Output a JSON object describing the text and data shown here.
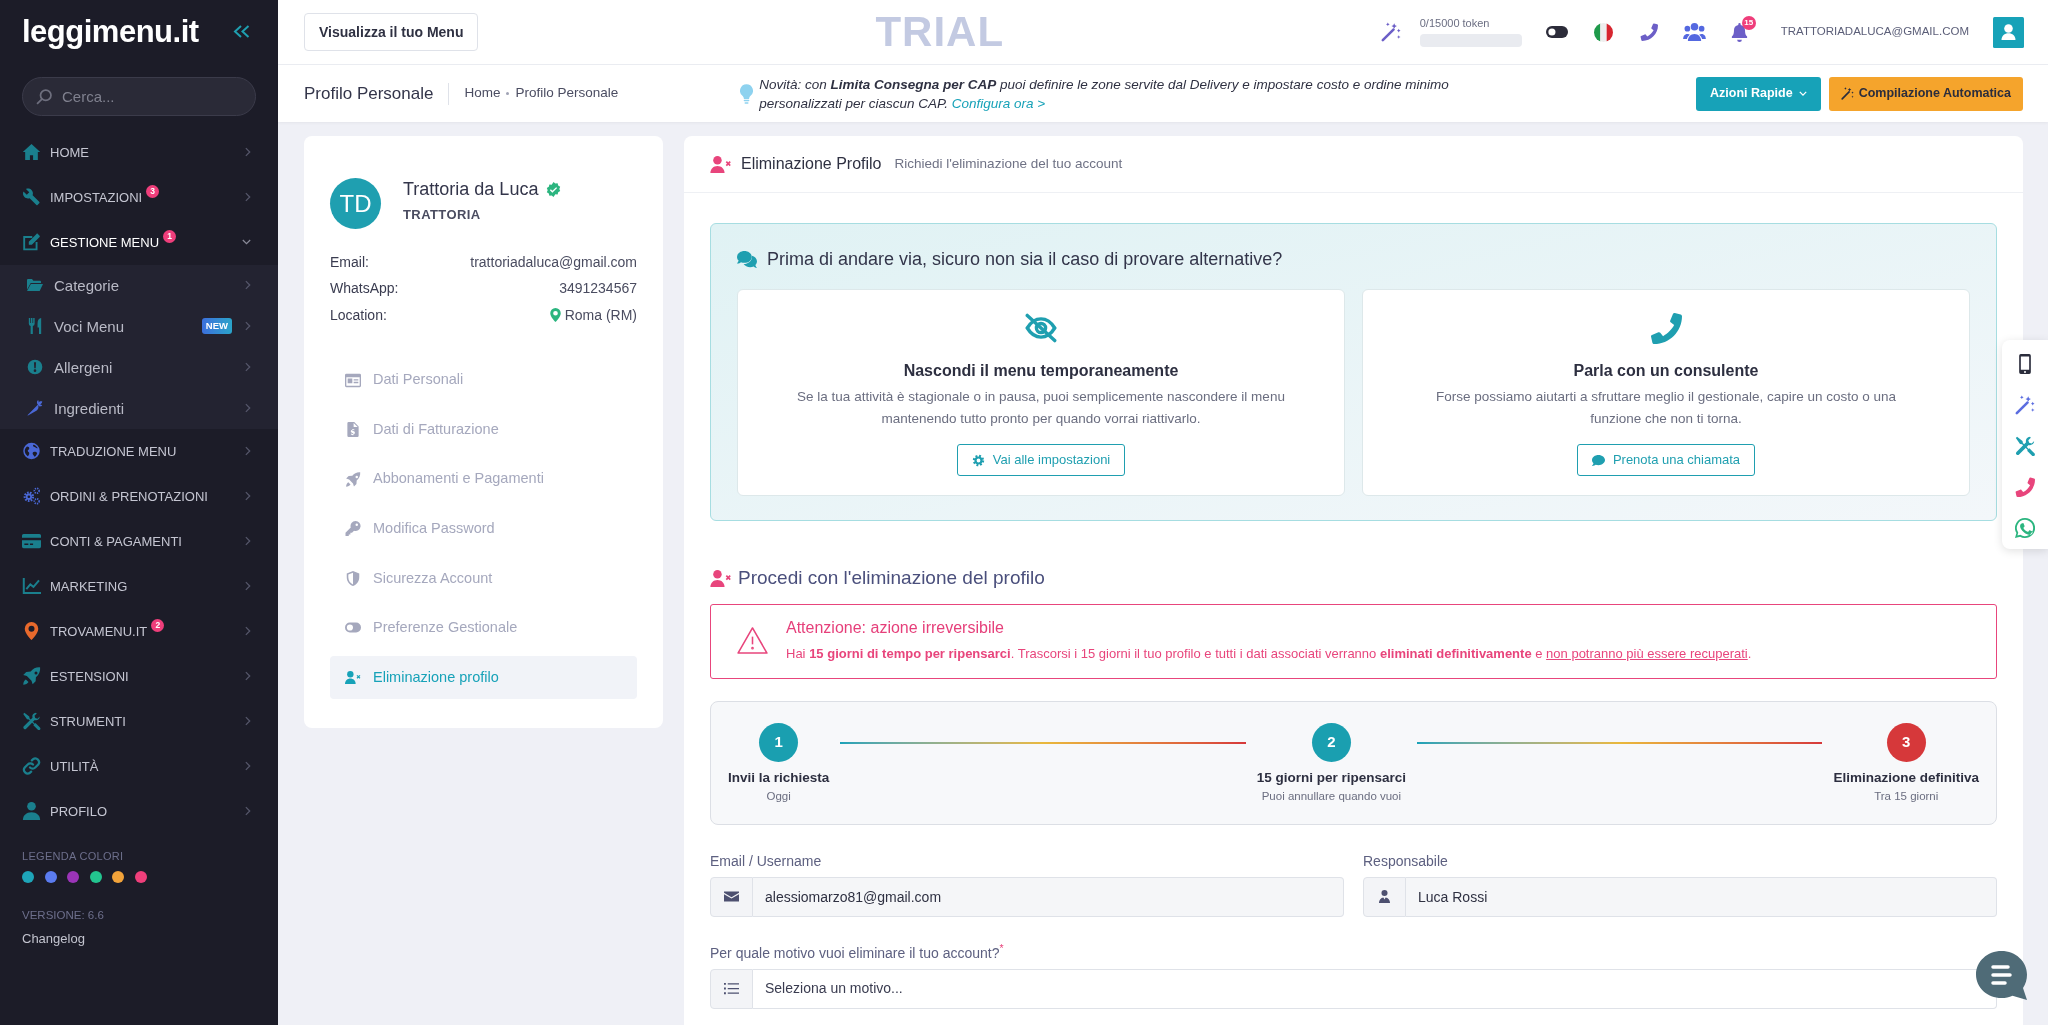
{
  "sidebar": {
    "logo": "leggimenu.it",
    "search": {
      "placeholder": "Cerca..."
    },
    "items": [
      {
        "label": "HOME",
        "color": "#1a7f8d",
        "expanded": false
      },
      {
        "label": "IMPOSTAZIONI",
        "color": "#1a7f8d",
        "badge": {
          "text": "3",
          "kind": "count"
        },
        "expanded": false
      },
      {
        "label": "GESTIONE MENU",
        "color": "#1a7f8d",
        "badge": {
          "text": "1",
          "kind": "count"
        },
        "expanded": true,
        "children": [
          {
            "label": "Categorie",
            "color": "#1a7f8d"
          },
          {
            "label": "Voci Menu",
            "color": "#1a7f8d",
            "badge": {
              "text": "NEW",
              "kind": "new"
            }
          },
          {
            "label": "Allergeni",
            "color": "#1a7f8d"
          },
          {
            "label": "Ingredienti",
            "color": "#4a68d6"
          }
        ]
      },
      {
        "label": "TRADUZIONE MENU",
        "color": "#4a68d6",
        "expanded": false
      },
      {
        "label": "ORDINI & PRENOTAZIONI",
        "color": "#4a68d6",
        "expanded": false
      },
      {
        "label": "CONTI & PAGAMENTI",
        "color": "#1a7f8d",
        "expanded": false
      },
      {
        "label": "MARKETING",
        "color": "#1a7f8d",
        "expanded": false
      },
      {
        "label": "TROVAMENU.IT",
        "color": "#e8692c",
        "badge": {
          "text": "2",
          "kind": "count"
        },
        "expanded": false
      },
      {
        "label": "ESTENSIONI",
        "color": "#1a7f8d",
        "expanded": false
      },
      {
        "label": "STRUMENTI",
        "color": "#1a7f8d",
        "expanded": false
      },
      {
        "label": "UTILITÀ",
        "color": "#1a7f8d",
        "expanded": false
      },
      {
        "label": "PROFILO",
        "color": "#1a7f8d",
        "expanded": false
      }
    ],
    "legend": {
      "title": "LEGENDA COLORI",
      "colors": [
        {
          "color": "#1ea5b9"
        },
        {
          "color": "#5b7cf0"
        },
        {
          "color": "#9b34b8"
        },
        {
          "color": "#23c48f"
        },
        {
          "color": "#f2a33a"
        },
        {
          "color": "#ef3f7b"
        }
      ]
    },
    "version": "VERSIONE: 6.6",
    "changelog": "Changelog"
  },
  "header": {
    "view_menu_button": "Visualizza il tuo Menu",
    "plan_label": "TRIAL",
    "tokens": {
      "text": "0/15000 token",
      "level": 0
    },
    "notifications_badge": "15",
    "user_email": "TRATTORIADALUCA@GMAIL.COM"
  },
  "subheader": {
    "title": "Profilo Personale",
    "breadcrumb": [
      {
        "label": "Home"
      },
      {
        "label": "Profilo Personale"
      }
    ],
    "notice": {
      "text": "Novità: con **Limita Consegna per CAP** puoi definire le zone servite dal Delivery e impostare costo e ordine minimo personalizzati per ciascun CAP.",
      "link": "Configura ora >"
    },
    "quick_actions_button": "Azioni Rapide",
    "autofill_button": "Compilazione Automatica"
  },
  "profile_card": {
    "initials": "TD",
    "name": "Trattoria da Luca",
    "verified": true,
    "type": "TRATTORIA",
    "details": [
      {
        "label": "Email:",
        "value": "trattoriadaluca@gmail.com",
        "kind": "text"
      },
      {
        "label": "WhatsApp:",
        "value": "3491234567",
        "kind": "text"
      },
      {
        "label": "Location:",
        "value": "Roma (RM)",
        "kind": "location"
      }
    ],
    "nav": [
      {
        "label": "Dati Personali",
        "selected": false
      },
      {
        "label": "Dati di Fatturazione",
        "selected": false
      },
      {
        "label": "Abbonamenti e Pagamenti",
        "selected": false
      },
      {
        "label": "Modifica Password",
        "selected": false
      },
      {
        "label": "Sicurezza Account",
        "selected": false
      },
      {
        "label": "Preferenze Gestionale",
        "selected": false
      },
      {
        "label": "Eliminazione profilo",
        "selected": true
      }
    ]
  },
  "main": {
    "title": "Eliminazione Profilo",
    "subtitle": "Richiedi l'eliminazione del tuo account",
    "alternatives": {
      "title": "Prima di andare via, sicuro non sia il caso di provare alternative?",
      "options": [
        {
          "title": "Nascondi il menu temporaneamente",
          "text": "Se la tua attività è stagionale o in pausa, puoi semplicemente nascondere il menu mantenendo tutto pronto per quando vorrai riattivarlo.",
          "button": "Vai alle impostazioni"
        },
        {
          "title": "Parla con un consulente",
          "text": "Forse possiamo aiutarti a sfruttare meglio il gestionale, capire un costo o una funzione che non ti torna.",
          "button": "Prenota una chiamata"
        }
      ]
    },
    "proceed_title": "Procedi con l'eliminazione del profilo",
    "warning": {
      "title": "Attenzione: azione irreversibile",
      "text": "Hai **15 giorni di tempo per ripensarci**. Trascorsi i 15 giorni il tuo profilo e tutti i dati associati verranno **eliminati definitivamente** e",
      "underlined": "non potranno più essere recuperati",
      "end": "."
    },
    "steps": [
      {
        "number": "1",
        "title": "Invii la richiesta",
        "subtitle": "Oggi",
        "color": "#1a9fb0"
      },
      {
        "number": "2",
        "title": "15 giorni per ripensarci",
        "subtitle": "Puoi annullare quando vuoi",
        "color": "#1a9fb0"
      },
      {
        "number": "3",
        "title": "Eliminazione definitiva",
        "subtitle": "Tra 15 giorni",
        "color": "#d6383a"
      }
    ],
    "fields": [
      {
        "kind": "input",
        "label": "Email / Username",
        "value": "alessiomarzo81@gmail.com"
      },
      {
        "kind": "input",
        "label": "Responsabile",
        "value": "Luca Rossi"
      },
      {
        "kind": "select",
        "label": "Per quale motivo vuoi eliminare il tuo account?$^{*}$",
        "placeholder": "Seleziona un motivo..."
      }
    ]
  }
}
